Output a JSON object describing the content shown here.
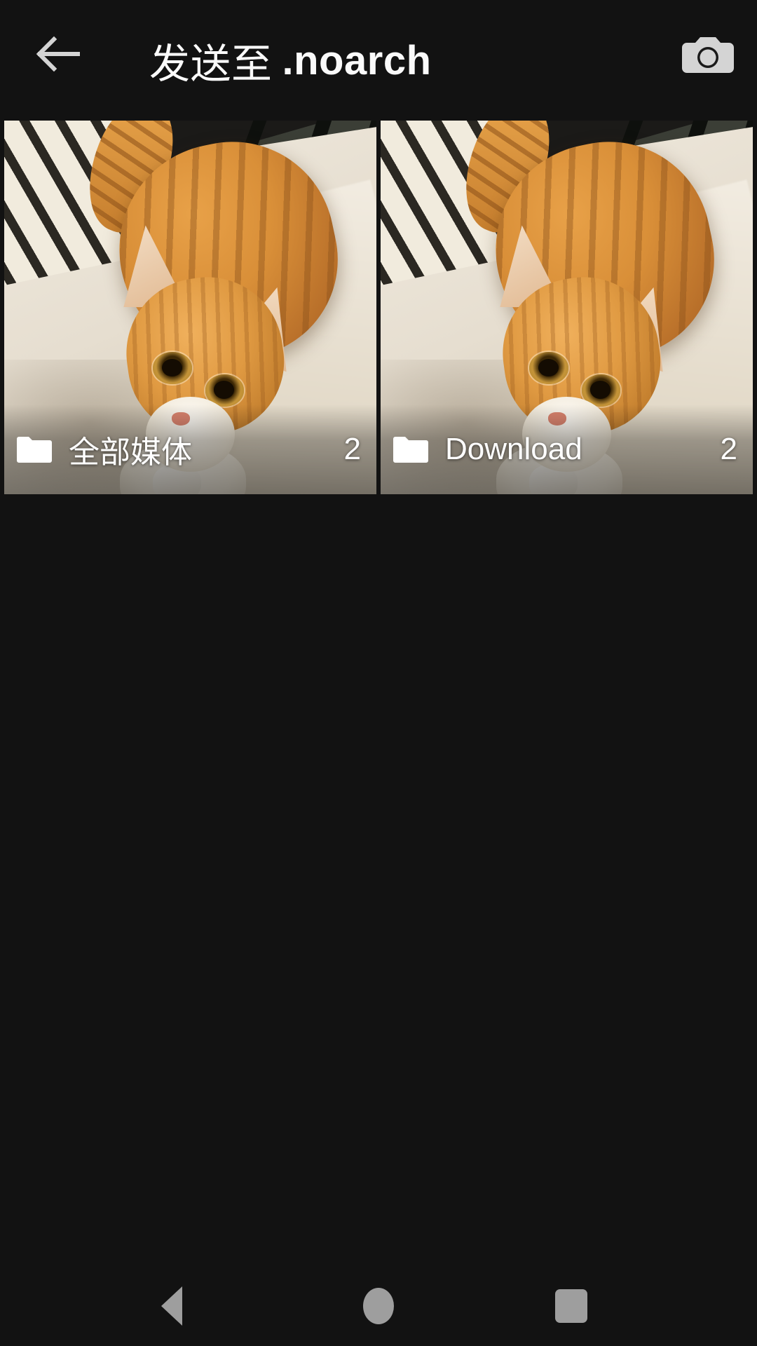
{
  "window": {
    "background_color": "#121212"
  },
  "appbar": {
    "back_icon": "arrow-left-icon",
    "title_prefix": "发送至",
    "title_name": ".noarch",
    "camera_icon": "camera-icon",
    "text_color": "#fafafa"
  },
  "albums": [
    {
      "folder_icon": "folder-icon",
      "name": "全部媒体",
      "count": "2",
      "thumbnail": "orange-tabby-cat-on-white-bed"
    },
    {
      "folder_icon": "folder-icon",
      "name": "Download",
      "count": "2",
      "thumbnail": "orange-tabby-cat-on-white-bed"
    }
  ],
  "navbar": {
    "back_label": "back-triangle",
    "home_label": "home-circle",
    "recents_label": "recents-square",
    "icon_color": "#9e9e9e"
  }
}
